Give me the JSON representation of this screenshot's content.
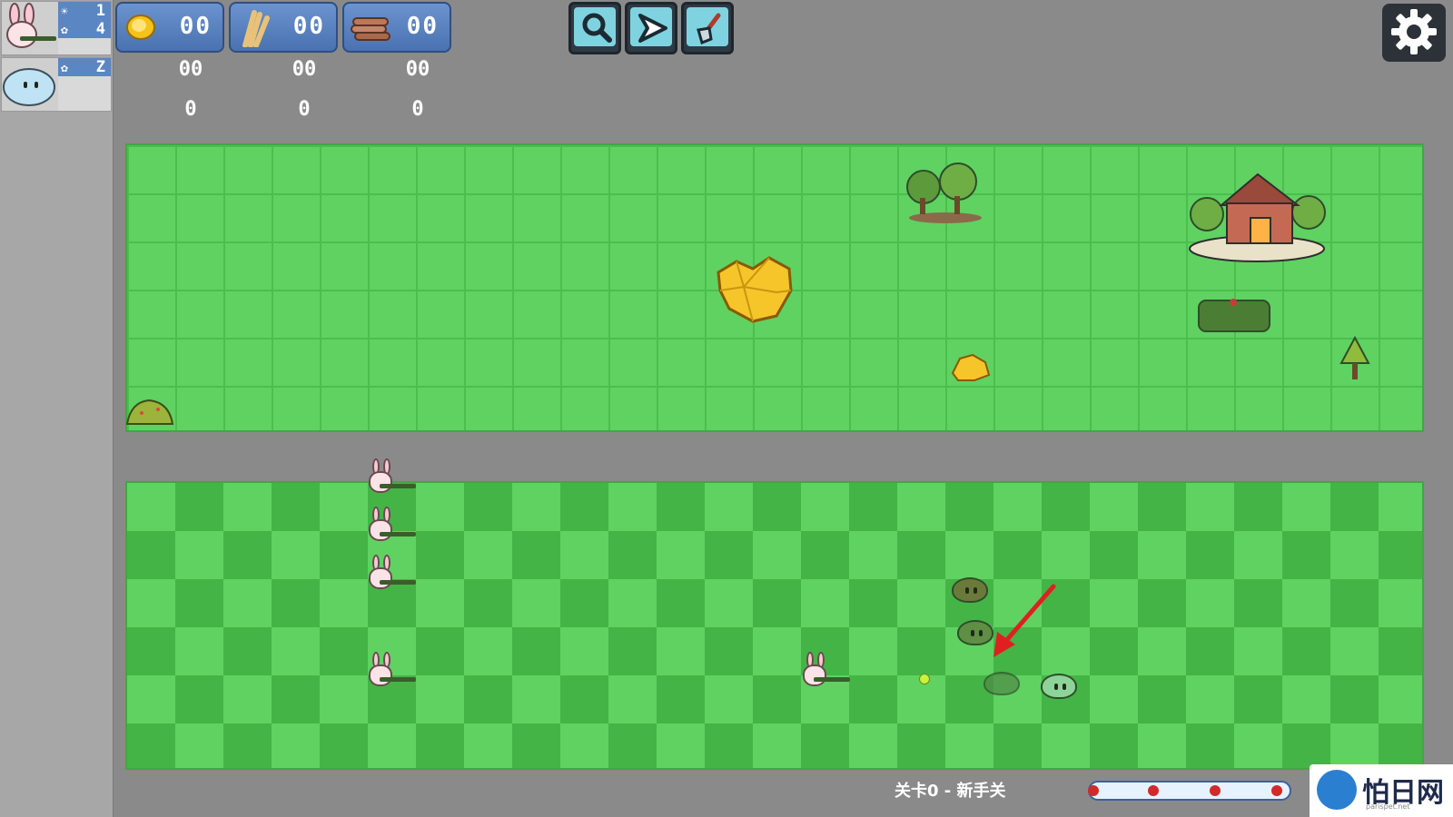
{
  "roster": [
    {
      "name": "bunny-gunner",
      "stat_top": "1",
      "stat_bottom": "4"
    },
    {
      "name": "blue-slime",
      "stat_top": "Z"
    }
  ],
  "resources": [
    {
      "icon": "gold-coin-icon",
      "value": "00",
      "sub1": "00",
      "sub2": "0"
    },
    {
      "icon": "wheat-icon",
      "value": "00",
      "sub1": "00",
      "sub2": "0"
    },
    {
      "icon": "wood-logs-icon",
      "value": "00",
      "sub1": "00",
      "sub2": "0"
    }
  ],
  "toolbar": [
    {
      "icon": "magnifier-icon"
    },
    {
      "icon": "play-arrow-icon"
    },
    {
      "icon": "shovel-icon"
    }
  ],
  "settings": {
    "icon": "gear-icon"
  },
  "level": {
    "label": "关卡0 - 新手关"
  },
  "wave_progress": {
    "skull_markers": 4
  },
  "watermark": {
    "brand": "怕日网",
    "url": "parispet.net"
  },
  "colors": {
    "grass_light": "#5fd262",
    "grass_dark": "#44b447",
    "panel_blue": "#5b86c4"
  }
}
